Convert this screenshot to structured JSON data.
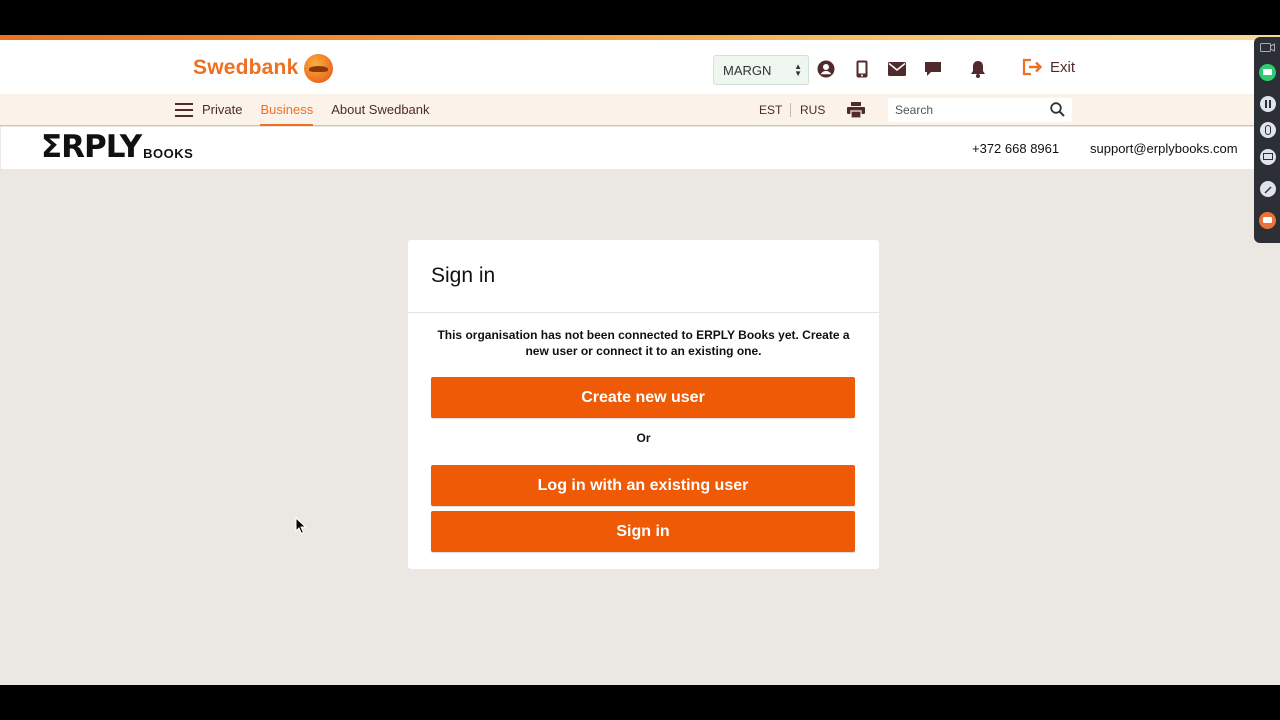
{
  "header": {
    "logo_text": "Swedbank",
    "org_select": {
      "value": "MARGN"
    },
    "exit_label": "Exit",
    "icons": [
      "user-icon",
      "phone-icon",
      "mail-icon",
      "chat-icon",
      "bell-icon",
      "exit-icon"
    ],
    "accent_color": "#ee7023"
  },
  "nav": {
    "items": [
      {
        "label": "Private"
      },
      {
        "label": "Business"
      },
      {
        "label": "About Swedbank"
      }
    ],
    "lang_est": "EST",
    "lang_rus": "RUS",
    "search_placeholder": "Search"
  },
  "erply": {
    "logo_main": "ΣRPLY",
    "logo_sub": "BOOKS",
    "phone": "+372 668 8961",
    "email": "support@erplybooks.com"
  },
  "card": {
    "title": "Sign in",
    "message": "This organisation has not been connected to ERPLY Books yet. Create a new user or connect it to an existing one.",
    "create_label": "Create new user",
    "or_label": "Or",
    "existing_label": "Log in with an existing user",
    "signin_label": "Sign in",
    "button_color": "#ee5a06"
  }
}
